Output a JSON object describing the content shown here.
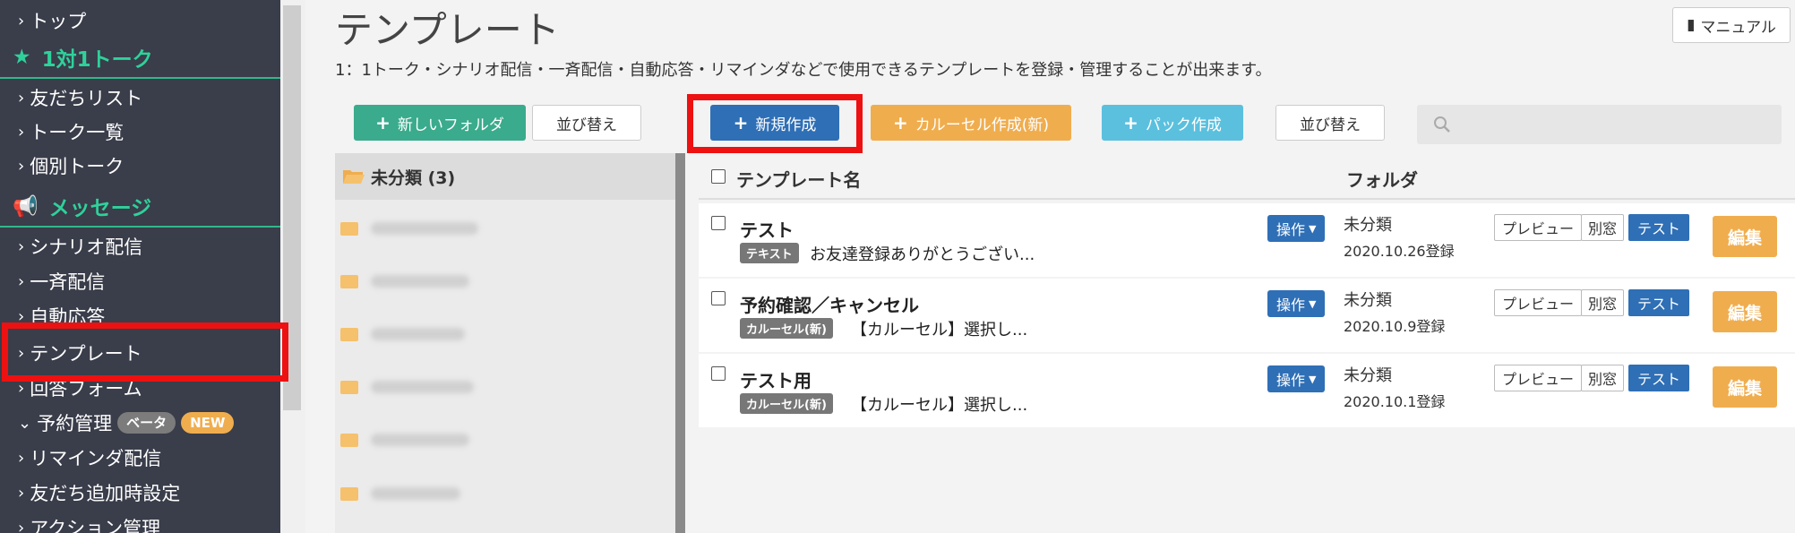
{
  "sidebar": {
    "items": [
      {
        "label": "トップ"
      },
      {
        "label": "1対1トーク"
      },
      {
        "label": "友だちリスト"
      },
      {
        "label": "トーク一覧"
      },
      {
        "label": "個別トーク"
      },
      {
        "label": "メッセージ"
      },
      {
        "label": "シナリオ配信"
      },
      {
        "label": "一斉配信"
      },
      {
        "label": "自動応答"
      },
      {
        "label": "テンプレート"
      },
      {
        "label": "回答フォーム"
      },
      {
        "label": "予約管理"
      },
      {
        "label": "リマインダ配信"
      },
      {
        "label": "友だち追加時設定"
      },
      {
        "label": "アクション管理"
      }
    ],
    "badges": {
      "beta": "ベータ",
      "new": "NEW"
    }
  },
  "header": {
    "title": "テンプレート",
    "description": "1：1トーク・シナリオ配信・一斉配信・自動応答・リマインダなどで使用できるテンプレートを登録・管理することが出来ます。",
    "manual_label": "マニュアル"
  },
  "toolbar": {
    "new_folder": "新しいフォルダ",
    "sort_folders": "並び替え",
    "new_create": "新規作成",
    "carousel_create": "カルーセル作成(新)",
    "pack_create": "パック作成",
    "sort_templates": "並び替え"
  },
  "folders": {
    "header": "未分類 (3)"
  },
  "table": {
    "col_name": "テンプレート名",
    "col_folder": "フォルダ",
    "rows": [
      {
        "title": "テスト",
        "type": "テキスト",
        "preview": "お友達登録ありがとうござい...",
        "folder": "未分類",
        "date": "2020.10.26登録"
      },
      {
        "title": "予約確認／キャンセル",
        "type": "カルーセル(新)",
        "preview": "【カルーセル】選択し...",
        "folder": "未分類",
        "date": "2020.10.9登録"
      },
      {
        "title": "テスト用",
        "type": "カルーセル(新)",
        "preview": "【カルーセル】選択し...",
        "folder": "未分類",
        "date": "2020.10.1登録"
      }
    ],
    "actions": {
      "operate": "操作",
      "preview": "プレビュー",
      "popup": "別窓",
      "test": "テスト",
      "edit": "編集"
    }
  },
  "colors": {
    "sidebar_bg": "#3a3d4a",
    "accent_green": "#2fd19a",
    "primary_blue": "#2f6fb6",
    "orange": "#f0ad4e",
    "highlight_red": "#ee1111"
  }
}
